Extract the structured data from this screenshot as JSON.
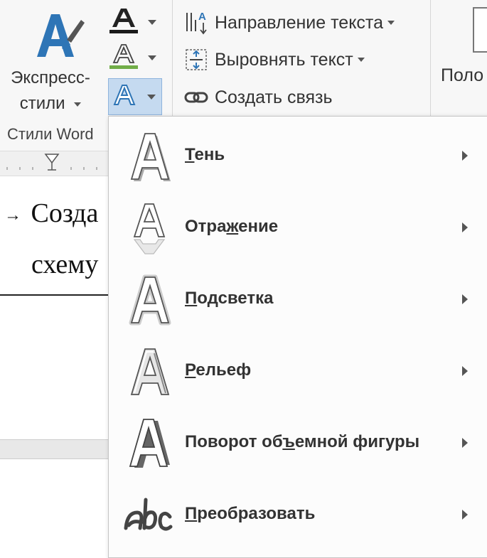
{
  "ribbon": {
    "express_styles": {
      "line1": "Экспресс-",
      "line2": "стили"
    },
    "group_label": "Стили Word",
    "text_fill_icon": "text-fill-a-icon",
    "text_outline_icon": "text-outline-a-icon",
    "text_effects_icon": "text-effects-a-icon",
    "text_direction": {
      "label": "Направление текста",
      "icon": "text-direction-icon"
    },
    "align_text": {
      "label": "Выровнять текст",
      "icon": "align-text-icon"
    },
    "create_link": {
      "label": "Создать связь",
      "icon": "link-icon"
    },
    "position": {
      "label": "Поло",
      "icon": "position-icon"
    },
    "colors": {
      "accent": "#2e75b6",
      "fill_bar": "#1a1a1a",
      "outline_bar": "#70ad47",
      "effects_highlight": "#c5daf0"
    }
  },
  "document": {
    "line1": "Созда",
    "line2": "схему",
    "bullet_arrow": "→"
  },
  "menu": {
    "items": [
      {
        "first": "Т",
        "rest": "ень",
        "icon": "shadow-a-icon"
      },
      {
        "pre": "Отра",
        "ul": "ж",
        "post": "ение",
        "icon": "reflection-a-icon"
      },
      {
        "first": "П",
        "rest": "одсветка",
        "icon": "glow-a-icon"
      },
      {
        "first": "Р",
        "rest": "ельеф",
        "icon": "bevel-a-icon"
      },
      {
        "pre": "Поворот об",
        "ul": "ъ",
        "post": "емной фигуры",
        "icon": "3d-rotation-a-icon"
      },
      {
        "first": "П",
        "rest": "реобразовать",
        "icon": "transform-abc-icon"
      }
    ]
  }
}
